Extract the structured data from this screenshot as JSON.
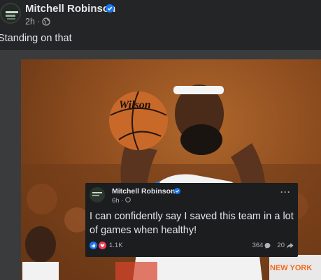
{
  "post": {
    "author": "Mitchell Robinson",
    "time": "2h",
    "separator": "·",
    "caption": "Standing on that"
  },
  "quote": {
    "author": "Mitchell Robinson",
    "time": "6h",
    "separator": "·",
    "more": "···",
    "text": "I can confidently say I saved this team in a lot of games when healthy!",
    "reactions": "1.1K",
    "comments": "364",
    "shares": "20"
  },
  "photo": {
    "ball_brand": "Wilson",
    "jersey_text": "NEW YORK"
  },
  "colors": {
    "background": "#242526",
    "verified": "#1877f2",
    "like": "#1877f2",
    "love": "#f33e58",
    "photo_bg": "#9a5322"
  }
}
